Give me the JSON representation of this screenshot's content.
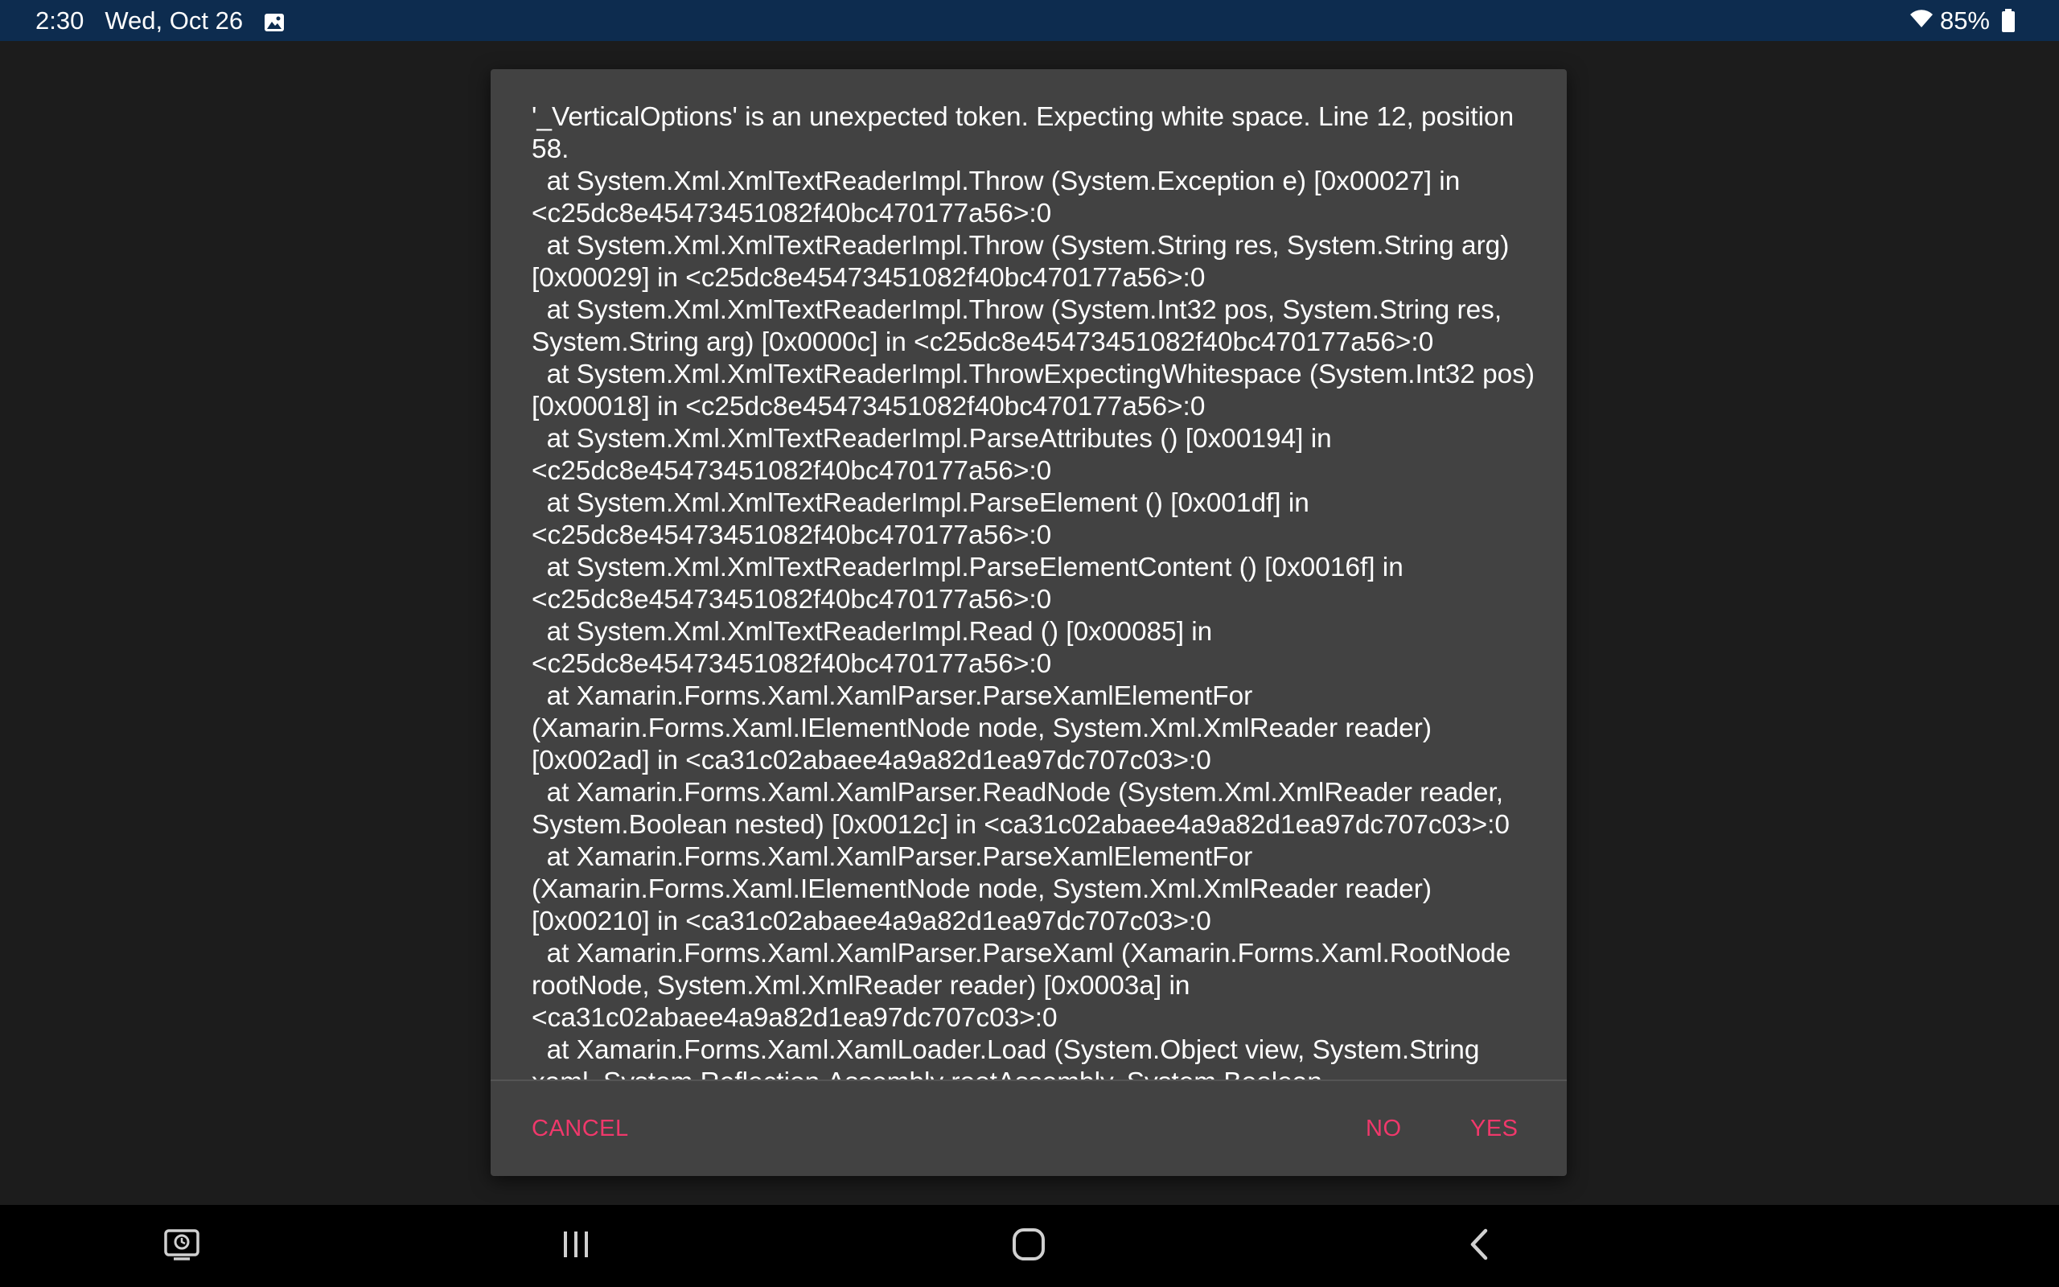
{
  "status_bar": {
    "time": "2:30",
    "date": "Wed, Oct 26",
    "battery_percent": "85%",
    "icons": [
      "gallery-icon",
      "wifi-icon",
      "battery-icon"
    ]
  },
  "dialog": {
    "message": "'_VerticalOptions' is an unexpected token. Expecting white space. Line 12, position 58.\n  at System.Xml.XmlTextReaderImpl.Throw (System.Exception e) [0x00027] in <c25dc8e45473451082f40bc470177a56>:0\n  at System.Xml.XmlTextReaderImpl.Throw (System.String res, System.String arg) [0x00029] in <c25dc8e45473451082f40bc470177a56>:0\n  at System.Xml.XmlTextReaderImpl.Throw (System.Int32 pos, System.String res, System.String arg) [0x0000c] in <c25dc8e45473451082f40bc470177a56>:0\n  at System.Xml.XmlTextReaderImpl.ThrowExpectingWhitespace (System.Int32 pos) [0x00018] in <c25dc8e45473451082f40bc470177a56>:0\n  at System.Xml.XmlTextReaderImpl.ParseAttributes () [0x00194] in <c25dc8e45473451082f40bc470177a56>:0\n  at System.Xml.XmlTextReaderImpl.ParseElement () [0x001df] in <c25dc8e45473451082f40bc470177a56>:0\n  at System.Xml.XmlTextReaderImpl.ParseElementContent () [0x0016f] in <c25dc8e45473451082f40bc470177a56>:0\n  at System.Xml.XmlTextReaderImpl.Read () [0x00085] in <c25dc8e45473451082f40bc470177a56>:0\n  at Xamarin.Forms.Xaml.XamlParser.ParseXamlElementFor (Xamarin.Forms.Xaml.IElementNode node, System.Xml.XmlReader reader) [0x002ad] in <ca31c02abaee4a9a82d1ea97dc707c03>:0\n  at Xamarin.Forms.Xaml.XamlParser.ReadNode (System.Xml.XmlReader reader, System.Boolean nested) [0x0012c] in <ca31c02abaee4a9a82d1ea97dc707c03>:0\n  at Xamarin.Forms.Xaml.XamlParser.ParseXamlElementFor (Xamarin.Forms.Xaml.IElementNode node, System.Xml.XmlReader reader) [0x00210] in <ca31c02abaee4a9a82d1ea97dc707c03>:0\n  at Xamarin.Forms.Xaml.XamlParser.ParseXaml (Xamarin.Forms.Xaml.RootNode rootNode, System.Xml.XmlReader reader) [0x0003a] in <ca31c02abaee4a9a82d1ea97dc707c03>:0\n  at Xamarin.Forms.Xaml.XamlLoader.Load (System.Object view, System.String xaml, System.Reflection.Assembly rootAssembly, System.Boolean",
    "buttons": {
      "cancel": "CANCEL",
      "no": "NO",
      "yes": "YES"
    },
    "accent_color": "#f0386b"
  },
  "nav_bar": {
    "icons": [
      "recent-screens-icon",
      "recent-apps-icon",
      "home-icon",
      "back-icon"
    ]
  }
}
